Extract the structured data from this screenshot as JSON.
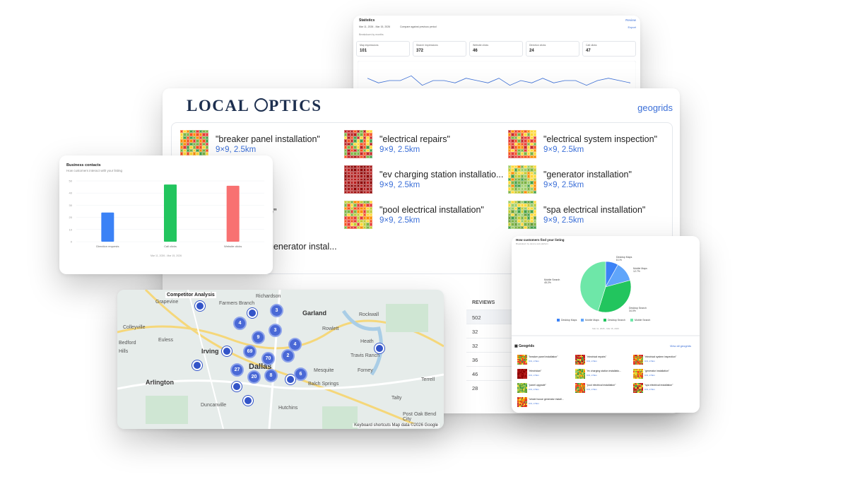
{
  "brand": {
    "logo_pre": "LOCAL ",
    "logo_post": "PTICS",
    "geogrids_link": "geogrids"
  },
  "geogrids": [
    {
      "keyword": "\"breaker panel installation\"",
      "size": "9×9, 2.5km"
    },
    {
      "keyword": "\"electrical repairs\"",
      "size": "9×9, 2.5km"
    },
    {
      "keyword": "\"electrical system inspection\"",
      "size": "9×9, 2.5km"
    },
    {
      "keyword": "\"ev charging station installatio...",
      "size": "9×9, 2.5km"
    },
    {
      "keyword": "\"generator installation\"",
      "size": "9×9, 2.5km"
    },
    {
      "keyword": "\"pool electrical installation\"",
      "size": "9×9, 2.5km"
    },
    {
      "keyword": "\"spa electrical installation\"",
      "size": "9×9, 2.5km"
    }
  ],
  "partial_keyword": "generator instal...",
  "partial_fragment": "e\"",
  "reviews_table": {
    "header": "REVIEWS",
    "values": [
      "502",
      "32",
      "32",
      "36",
      "46",
      "28"
    ]
  },
  "statistics": {
    "title": "Statistics",
    "review_link": "Review",
    "date_range": "Mar 11, 2026 - Mar 15, 2026",
    "compare_label": "Compare against previous period",
    "export": "Export",
    "breakdown": "Breakdown by months",
    "metrics": [
      {
        "label": "Map impressions",
        "value": "101"
      },
      {
        "label": "Search impressions",
        "value": "372"
      },
      {
        "label": "Website clicks",
        "value": "46"
      },
      {
        "label": "Direction clicks",
        "value": "24"
      },
      {
        "label": "Call clicks",
        "value": "47"
      }
    ],
    "chart_title": "Location listing visits",
    "chart_sub": "The number of times showing your account in Maps and Search"
  },
  "business_contacts": {
    "title": "Business contacts",
    "subtitle": "How customers interact with your listing",
    "date": "Mar 11, 2026 - Mar 15, 2026"
  },
  "competitor": {
    "title": "Competitor Analysis",
    "cities": [
      "Garland",
      "Irving",
      "Dallas",
      "Arlington",
      "Mesquite",
      "Grapevine",
      "Rockwall",
      "Colleyville",
      "Euless",
      "Farmers Branch",
      "Richardson",
      "Heath",
      "Travis Ranch",
      "Forney",
      "Balch Springs",
      "Duncanville",
      "Hutchins",
      "Terrell",
      "Talty",
      "Post Oak Bend City",
      "Rowlett",
      "Hills",
      "Bedford"
    ],
    "clusters": [
      "3",
      "4",
      "3",
      "9",
      "69",
      "70",
      "4",
      "2",
      "27",
      "8",
      "6",
      "20"
    ],
    "attribution": "Keyboard shortcuts   Map data ©2026 Google"
  },
  "pie": {
    "title": "How customers find your listing",
    "subtitle": "Breakdown by device and platform",
    "labels": {
      "desktop_maps": "Desktop Maps 8.1%",
      "mobile_maps": "Mobile Maps 12.7%",
      "desktop_search": "Desktop Search 34.0%",
      "mobile_search": "Mobile Search 45.2%"
    },
    "legend": [
      "Desktop Maps",
      "Mobile Maps",
      "Desktop Search",
      "Mobile Search"
    ],
    "date": "Mar 11, 2026 - Mar 15, 2026",
    "geogrids_title": "Geogrids",
    "view_all": "View all geogrids",
    "small_grids": [
      {
        "k": "\"breaker panel installation\"",
        "s": "9×9, 2.5km"
      },
      {
        "k": "\"electrical repairs\"",
        "s": "9×9, 2.5km"
      },
      {
        "k": "\"electrical system inspection\"",
        "s": "9×9, 2.5km"
      },
      {
        "k": "\"electrician\"",
        "s": "9×9, 2.5km"
      },
      {
        "k": "\"ev charging station installatio...",
        "s": "9×9, 2.5km"
      },
      {
        "k": "\"generator installation\"",
        "s": "9×9, 2.5km"
      },
      {
        "k": "\"panel upgrade\"",
        "s": "9×9, 2.5km"
      },
      {
        "k": "\"pool electrical installation\"",
        "s": "9×9, 2.5km"
      },
      {
        "k": "\"spa electrical installation\"",
        "s": "9×9, 2.5km"
      },
      {
        "k": "\"whole house generator install...",
        "s": "9×9, 2.5km"
      }
    ]
  },
  "chart_data": [
    {
      "type": "bar",
      "title": "Business contacts",
      "categories": [
        "Direction requests",
        "Call clicks",
        "Website clicks"
      ],
      "values": [
        24,
        47,
        46
      ],
      "colors": [
        "#3b82f6",
        "#22c55e",
        "#f87171"
      ],
      "ylim": [
        0,
        50
      ],
      "yticks": [
        "0",
        "10",
        "20",
        "30",
        "40",
        "50"
      ]
    },
    {
      "type": "pie",
      "title": "How customers find your listing",
      "categories": [
        "Desktop Maps",
        "Mobile Maps",
        "Desktop Search",
        "Mobile Search"
      ],
      "values": [
        8.1,
        12.7,
        34.0,
        45.2
      ],
      "colors": [
        "#3b82f6",
        "#60a5fa",
        "#22c55e",
        "#6ee7a8"
      ]
    },
    {
      "type": "line",
      "title": "Location listing visits",
      "series": [
        {
          "values": [
            7,
            5,
            6,
            6,
            8,
            4,
            6,
            6,
            5,
            7,
            6,
            5,
            7,
            4,
            6,
            5,
            7,
            5,
            6,
            6,
            4,
            6,
            7,
            6,
            5
          ]
        },
        {
          "values": [
            2,
            3,
            2,
            3,
            2,
            2,
            3,
            2,
            3,
            2,
            3,
            2,
            2,
            3,
            2,
            3,
            4,
            3,
            2,
            3,
            2,
            3,
            2,
            2,
            3
          ]
        }
      ],
      "colors": [
        "#3b6fd8",
        "#22c55e"
      ]
    }
  ]
}
